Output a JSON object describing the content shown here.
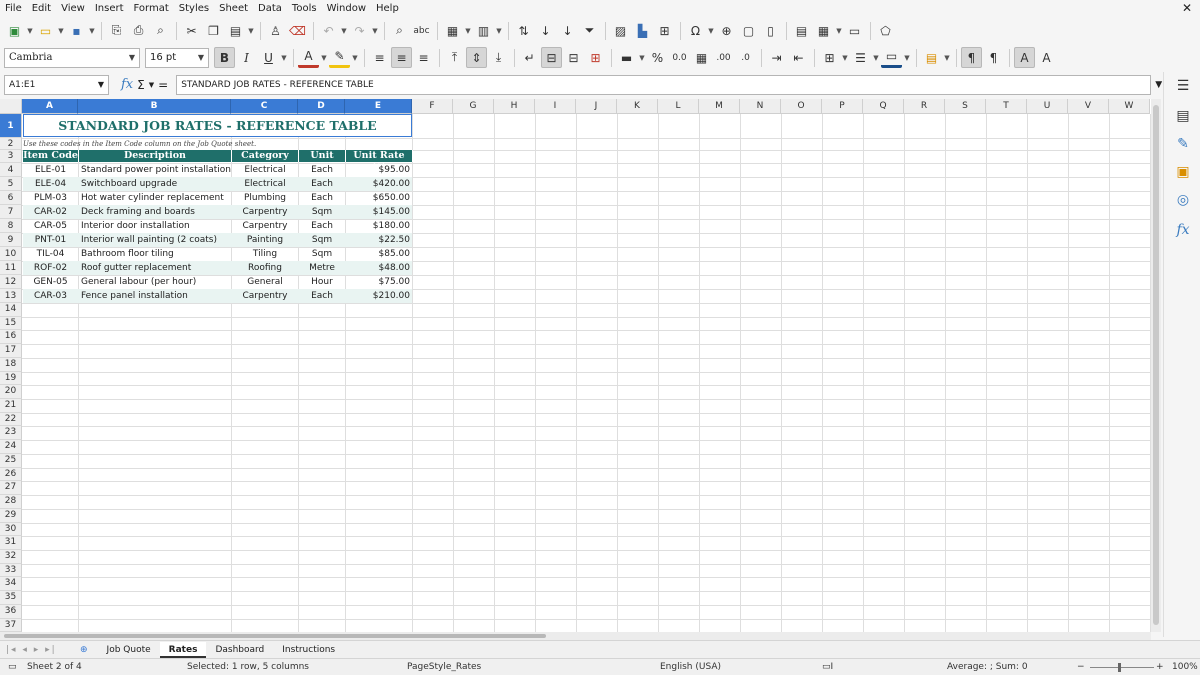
{
  "menu": [
    "File",
    "Edit",
    "View",
    "Insert",
    "Format",
    "Styles",
    "Sheet",
    "Data",
    "Tools",
    "Window",
    "Help"
  ],
  "font": {
    "name": "Cambria",
    "size": "16 pt"
  },
  "name_box": "A1:E1",
  "formula": "STANDARD JOB RATES - REFERENCE TABLE",
  "columns": [
    "A",
    "B",
    "C",
    "D",
    "E",
    "F",
    "G",
    "H",
    "I",
    "J",
    "K",
    "L",
    "M",
    "N",
    "O",
    "P",
    "Q",
    "R",
    "S",
    "T",
    "U",
    "V",
    "W"
  ],
  "rows": [
    "1",
    "2",
    "3",
    "4",
    "5",
    "6",
    "7",
    "8",
    "9",
    "10",
    "11",
    "12",
    "13",
    "14",
    "15",
    "16",
    "17",
    "18",
    "19",
    "20",
    "21",
    "22",
    "23",
    "24",
    "25",
    "26",
    "27",
    "28",
    "29",
    "30",
    "31",
    "32",
    "33",
    "34",
    "35",
    "36",
    "37"
  ],
  "sheet": {
    "title": "STANDARD JOB RATES - REFERENCE TABLE",
    "note": "Use these codes in the Item Code column on the Job Quote sheet.",
    "headers": [
      "Item Code",
      "Description",
      "Category",
      "Unit",
      "Unit Rate ($)"
    ],
    "rows": [
      [
        "ELE-01",
        "Standard power point installation",
        "Electrical",
        "Each",
        "$95.00"
      ],
      [
        "ELE-04",
        "Switchboard upgrade",
        "Electrical",
        "Each",
        "$420.00"
      ],
      [
        "PLM-03",
        "Hot water cylinder replacement",
        "Plumbing",
        "Each",
        "$650.00"
      ],
      [
        "CAR-02",
        "Deck framing and boards",
        "Carpentry",
        "Sqm",
        "$145.00"
      ],
      [
        "CAR-05",
        "Interior door installation",
        "Carpentry",
        "Each",
        "$180.00"
      ],
      [
        "PNT-01",
        "Interior wall painting (2 coats)",
        "Painting",
        "Sqm",
        "$22.50"
      ],
      [
        "TIL-04",
        "Bathroom floor tiling",
        "Tiling",
        "Sqm",
        "$85.00"
      ],
      [
        "ROF-02",
        "Roof gutter replacement",
        "Roofing",
        "Metre",
        "$48.00"
      ],
      [
        "GEN-05",
        "General labour (per hour)",
        "General",
        "Hour",
        "$75.00"
      ],
      [
        "CAR-03",
        "Fence panel installation",
        "Carpentry",
        "Each",
        "$210.00"
      ]
    ]
  },
  "tabs": [
    "Job Quote",
    "Rates",
    "Dashboard",
    "Instructions"
  ],
  "active_tab": "Rates",
  "status": {
    "sheet": "Sheet 2 of 4",
    "selection": "Selected: 1 row, 5 columns",
    "page_style": "PageStyle_Rates",
    "language": "English (USA)",
    "summary": "Average: ; Sum: 0",
    "zoom": "100%"
  },
  "colors": {
    "header_fill": "#1f6f6a",
    "title_text": "#1f6f6a",
    "selection": "#3a7bd5",
    "row_alt": "#e9f4f2"
  }
}
